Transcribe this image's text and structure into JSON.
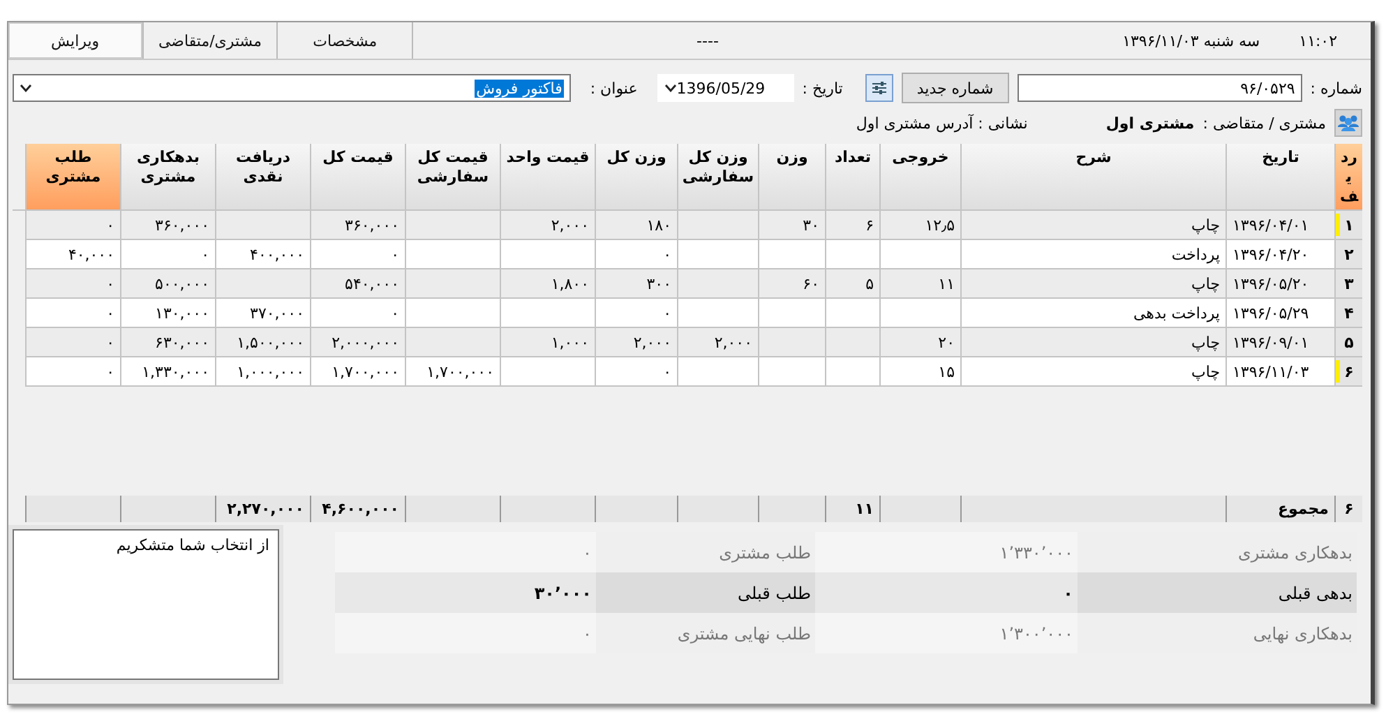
{
  "tabs": [
    {
      "label": "مشخصات",
      "selected": false
    },
    {
      "label": "مشتری/متقاضی",
      "selected": false
    },
    {
      "label": "ویرایش",
      "selected": true
    }
  ],
  "status_text": "----",
  "date_display": "سه شنبه  ۱۳۹۶/۱۱/۰۳",
  "clock": "۱۱:۰۲",
  "form": {
    "number_label": "شماره :",
    "number_value": "۹۶/۰۵۲۹",
    "new_number_button": "شماره جدید",
    "date_label": "تاریخ :",
    "date_value": "1396/05/29",
    "title_label": "عنوان :",
    "title_value": "فاکتور فروش",
    "title_value_selected": true,
    "customer_label": "مشتری / متقاضی :",
    "customer_name": "مشتری اول",
    "address": "نشانی : آدرس مشتری اول"
  },
  "table": {
    "columns": [
      {
        "label": "ردیف",
        "highlighted": true
      },
      {
        "label": "تاریخ",
        "highlighted": false
      },
      {
        "label": "شرح",
        "highlighted": false
      },
      {
        "label": "خروجی",
        "highlighted": false
      },
      {
        "label": "تعداد",
        "highlighted": false
      },
      {
        "label": "وزن",
        "highlighted": false
      },
      {
        "label": "وزن کل سفارشی",
        "highlighted": false
      },
      {
        "label": "وزن کل",
        "highlighted": false
      },
      {
        "label": "قیمت واحد",
        "highlighted": false
      },
      {
        "label": "قیمت کل سفارشی",
        "highlighted": false
      },
      {
        "label": "قیمت کل",
        "highlighted": false
      },
      {
        "label": "دریافت نقدی",
        "highlighted": false
      },
      {
        "label": "بدهکاری مشتری",
        "highlighted": false
      },
      {
        "label": "طلب مشتری",
        "highlighted": true
      }
    ],
    "rows": [
      {
        "flagged": true,
        "cells": [
          "۱",
          "۱۳۹۶/۰۴/۰۱",
          "چاپ",
          "۱۲٫۵",
          "۶",
          "۳۰",
          "",
          "۱۸۰",
          "۲,۰۰۰",
          "",
          "۳۶۰,۰۰۰",
          "",
          "۳۶۰,۰۰۰",
          "۰"
        ]
      },
      {
        "flagged": false,
        "cells": [
          "۲",
          "۱۳۹۶/۰۴/۲۰",
          "پرداخت",
          "",
          "",
          "",
          "",
          "۰",
          "",
          "",
          "۰",
          "۴۰۰,۰۰۰",
          "۰",
          "۴۰,۰۰۰"
        ]
      },
      {
        "flagged": false,
        "cells": [
          "۳",
          "۱۳۹۶/۰۵/۲۰",
          "چاپ",
          "۱۱",
          "۵",
          "۶۰",
          "",
          "۳۰۰",
          "۱,۸۰۰",
          "",
          "۵۴۰,۰۰۰",
          "",
          "۵۰۰,۰۰۰",
          "۰"
        ]
      },
      {
        "flagged": false,
        "cells": [
          "۴",
          "۱۳۹۶/۰۵/۲۹",
          "پرداخت بدهی",
          "",
          "",
          "",
          "",
          "۰",
          "",
          "",
          "۰",
          "۳۷۰,۰۰۰",
          "۱۳۰,۰۰۰",
          "۰"
        ]
      },
      {
        "flagged": false,
        "cells": [
          "۵",
          "۱۳۹۶/۰۹/۰۱",
          "چاپ",
          "۲۰",
          "",
          "",
          "۲,۰۰۰",
          "۲,۰۰۰",
          "۱,۰۰۰",
          "",
          "۲,۰۰۰,۰۰۰",
          "۱,۵۰۰,۰۰۰",
          "۶۳۰,۰۰۰",
          "۰"
        ]
      },
      {
        "flagged": true,
        "cells": [
          "۶",
          "۱۳۹۶/۱۱/۰۳",
          "چاپ",
          "۱۵",
          "",
          "",
          "",
          "۰",
          "",
          "۱,۷۰۰,۰۰۰",
          "۱,۷۰۰,۰۰۰",
          "۱,۰۰۰,۰۰۰",
          "۱,۳۳۰,۰۰۰",
          "۰"
        ]
      }
    ],
    "totals": {
      "row_count": "۶",
      "label": "مجموع",
      "quantity": "۱۱",
      "total_price": "۴,۶۰۰,۰۰۰",
      "cash_received": "۲,۲۷۰,۰۰۰"
    }
  },
  "note": "از انتخاب شما متشکریم",
  "summary": [
    {
      "emphasis": false,
      "cells": [
        "بدهکاری مشتری",
        "۱٬۳۳۰٬۰۰۰",
        "طلب مشتری",
        "۰"
      ]
    },
    {
      "emphasis": true,
      "cells": [
        "بدهی قبلی",
        "۰",
        "طلب قبلی",
        "۳۰٬۰۰۰"
      ]
    },
    {
      "emphasis": false,
      "cells": [
        "بدهکاری نهایی",
        "۱٬۳۰۰٬۰۰۰",
        "طلب نهایی مشتری",
        "۰"
      ]
    }
  ]
}
